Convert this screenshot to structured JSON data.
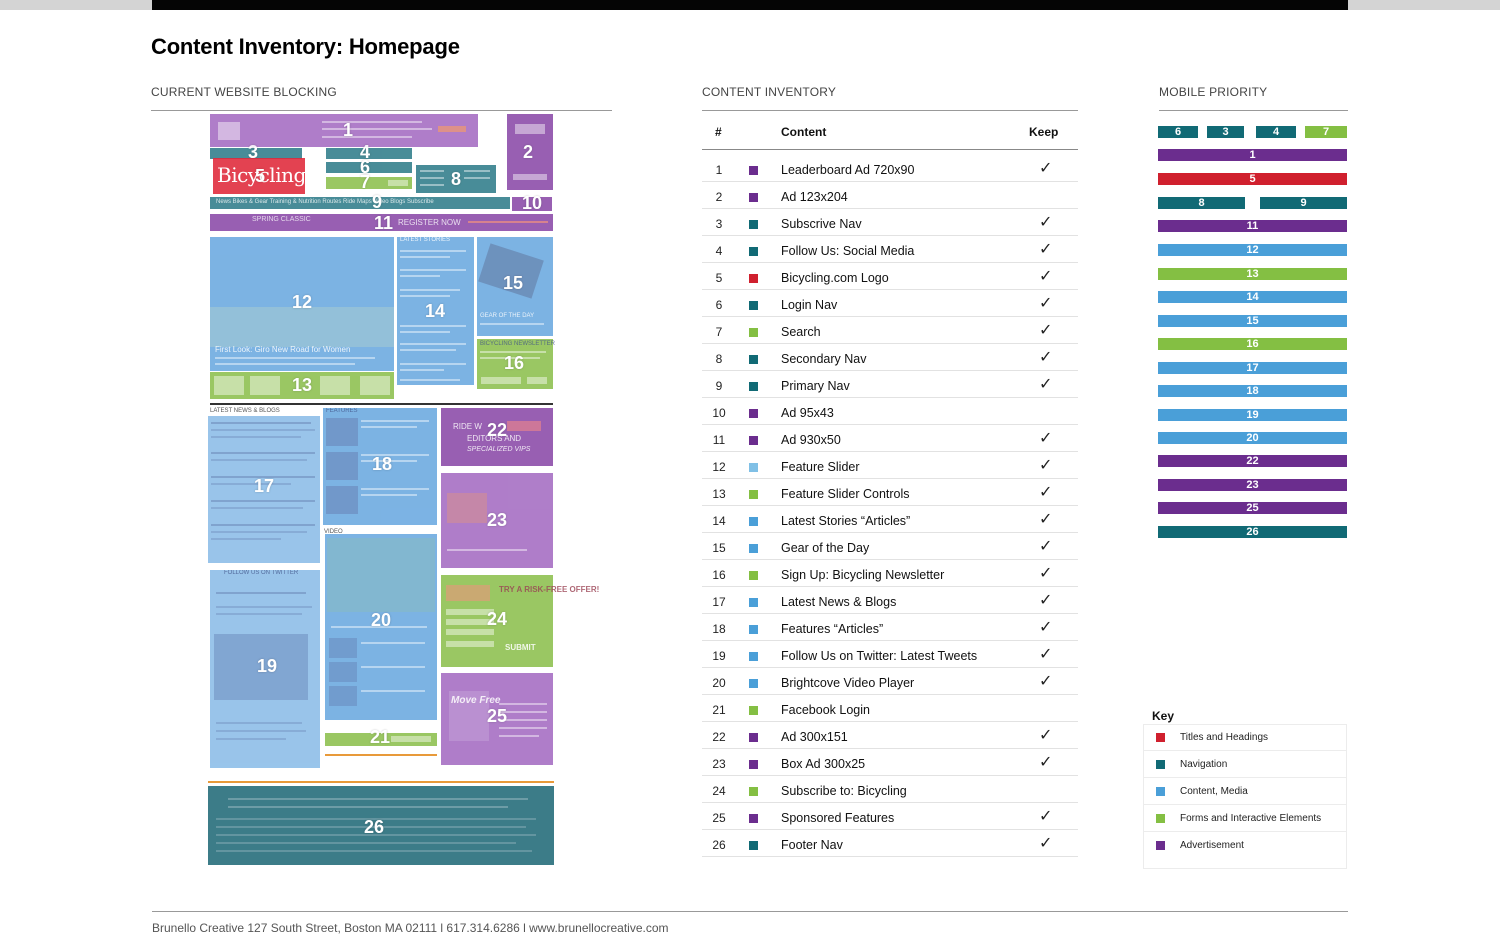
{
  "title": "Content Inventory: Homepage",
  "sections": {
    "blocking": "CURRENT WEBSITE BLOCKING",
    "inventory": "CONTENT INVENTORY",
    "mobile": "MOBILE PRIORITY"
  },
  "colors": {
    "titles": "#d0202e",
    "navigation": "#116a75",
    "content": "#4a9fd8",
    "forms": "#84bf43",
    "advertisement": "#6b2d8e"
  },
  "wireframe": {
    "logo_text": "Bicycling",
    "blocks": [
      "1",
      "2",
      "3",
      "4",
      "5",
      "6",
      "7",
      "8",
      "9",
      "10",
      "11",
      "12",
      "13",
      "14",
      "15",
      "16",
      "17",
      "18",
      "19",
      "20",
      "21",
      "22",
      "23",
      "24",
      "25",
      "26"
    ],
    "headings": {
      "latest_stories": "LATEST STORIES",
      "latest_news": "LATEST NEWS & BLOGS",
      "features": "FEATURES",
      "follow_twitter": "FOLLOW US ON TWITTER",
      "video": "VIDEO",
      "newsletter": "BICYCLING NEWSLETTER",
      "gear_of_day": "GEAR OF THE DAY",
      "slider_caption": "First Look: Giro New Road for Women",
      "register": "REGISTER NOW",
      "spring_classic": "SPRING CLASSIC",
      "ride_with": "RIDE W",
      "editors_and": "EDITORS AND",
      "specialized_vips": "SPECIALIZED VIPS",
      "try_offer": "TRY A RISK-FREE OFFER!",
      "submit": "SUBMIT",
      "move_free": "Move Free",
      "nav_items": "News   Bikes & Gear   Training & Nutrition   Routes   Ride Maps   Video   Blogs   Subscribe"
    }
  },
  "inventory": {
    "headers": {
      "num": "#",
      "content": "Content",
      "keep": "Keep"
    },
    "rows": [
      {
        "num": "1",
        "content": "Leaderboard Ad 720x90",
        "category": "advertisement",
        "keep": "✓"
      },
      {
        "num": "2",
        "content": "Ad 123x204",
        "category": "advertisement",
        "keep": ""
      },
      {
        "num": "3",
        "content": "Subscrive Nav",
        "category": "navigation",
        "keep": "✓"
      },
      {
        "num": "4",
        "content": "Follow Us: Social Media",
        "category": "navigation",
        "keep": "✓"
      },
      {
        "num": "5",
        "content": "Bicycling.com Logo",
        "category": "titles",
        "keep": "✓"
      },
      {
        "num": "6",
        "content": "Login Nav",
        "category": "navigation",
        "keep": "✓"
      },
      {
        "num": "7",
        "content": "Search",
        "category": "forms",
        "keep": "✓"
      },
      {
        "num": "8",
        "content": "Secondary Nav",
        "category": "navigation",
        "keep": "✓"
      },
      {
        "num": "9",
        "content": "Primary Nav",
        "category": "navigation",
        "keep": "✓"
      },
      {
        "num": "10",
        "content": "Ad 95x43",
        "category": "advertisement",
        "keep": ""
      },
      {
        "num": "11",
        "content": "Ad 930x50",
        "category": "advertisement",
        "keep": "✓"
      },
      {
        "num": "12",
        "content": "Feature Slider",
        "category": "content_light",
        "keep": "✓"
      },
      {
        "num": "13",
        "content": "Feature Slider Controls",
        "category": "forms",
        "keep": "✓"
      },
      {
        "num": "14",
        "content": "Latest Stories “Articles”",
        "category": "content",
        "keep": "✓"
      },
      {
        "num": "15",
        "content": "Gear of the Day",
        "category": "content",
        "keep": "✓"
      },
      {
        "num": "16",
        "content": "Sign Up: Bicycling Newsletter",
        "category": "forms",
        "keep": "✓"
      },
      {
        "num": "17",
        "content": "Latest News & Blogs",
        "category": "content",
        "keep": "✓"
      },
      {
        "num": "18",
        "content": "Features “Articles”",
        "category": "content",
        "keep": "✓"
      },
      {
        "num": "19",
        "content": "Follow Us on Twitter: Latest Tweets",
        "category": "content",
        "keep": "✓"
      },
      {
        "num": "20",
        "content": "Brightcove Video Player",
        "category": "content",
        "keep": "✓"
      },
      {
        "num": "21",
        "content": "Facebook Login",
        "category": "forms",
        "keep": ""
      },
      {
        "num": "22",
        "content": "Ad 300x151",
        "category": "advertisement",
        "keep": "✓"
      },
      {
        "num": "23",
        "content": "Box Ad 300x25",
        "category": "advertisement",
        "keep": "✓"
      },
      {
        "num": "24",
        "content": "Subscribe to: Bicycling",
        "category": "forms",
        "keep": ""
      },
      {
        "num": "25",
        "content": "Sponsored Features",
        "category": "advertisement",
        "keep": "✓"
      },
      {
        "num": "26",
        "content": "Footer Nav",
        "category": "navigation",
        "keep": "✓"
      }
    ]
  },
  "mobile_priority": [
    [
      {
        "label": "6",
        "category": "navigation"
      },
      {
        "label": "3",
        "category": "navigation"
      },
      {
        "label": "4",
        "category": "navigation"
      },
      {
        "label": "7",
        "category": "forms"
      }
    ],
    [
      {
        "label": "1",
        "category": "advertisement"
      }
    ],
    [
      {
        "label": "5",
        "category": "titles"
      }
    ],
    [
      {
        "label": "8",
        "category": "navigation"
      },
      {
        "label": "9",
        "category": "navigation"
      }
    ],
    [
      {
        "label": "11",
        "category": "advertisement"
      }
    ],
    [
      {
        "label": "12",
        "category": "content"
      }
    ],
    [
      {
        "label": "13",
        "category": "forms"
      }
    ],
    [
      {
        "label": "14",
        "category": "content"
      }
    ],
    [
      {
        "label": "15",
        "category": "content"
      }
    ],
    [
      {
        "label": "16",
        "category": "forms"
      }
    ],
    [
      {
        "label": "17",
        "category": "content"
      }
    ],
    [
      {
        "label": "18",
        "category": "content"
      }
    ],
    [
      {
        "label": "19",
        "category": "content"
      }
    ],
    [
      {
        "label": "20",
        "category": "content"
      }
    ],
    [
      {
        "label": "22",
        "category": "advertisement"
      }
    ],
    [
      {
        "label": "23",
        "category": "advertisement"
      }
    ],
    [
      {
        "label": "25",
        "category": "advertisement"
      }
    ],
    [
      {
        "label": "26",
        "category": "navigation"
      }
    ]
  ],
  "key": {
    "title": "Key",
    "items": [
      {
        "label": "Titles and Headings",
        "category": "titles"
      },
      {
        "label": "Navigation",
        "category": "navigation"
      },
      {
        "label": "Content, Media",
        "category": "content"
      },
      {
        "label": "Forms and Interactive Elements",
        "category": "forms"
      },
      {
        "label": "Advertisement",
        "category": "advertisement"
      }
    ]
  },
  "footer": {
    "text": "Brunello Creative 127 South Street, Boston MA 02111 l 617.314.6286 l ",
    "url": "www.brunellocreative.com"
  }
}
